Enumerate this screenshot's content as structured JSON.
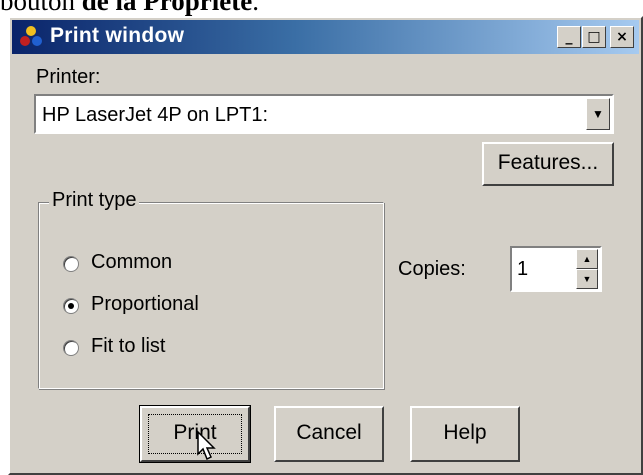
{
  "caption": {
    "prefix": "bouton ",
    "bold": "de la Propriété",
    "suffix": "."
  },
  "window": {
    "title": "Print window",
    "title_icon": "app-icon",
    "controls": {
      "minimize": "_",
      "maximize": "□",
      "close": "×"
    }
  },
  "printer": {
    "label": "Printer:",
    "selected": "HP LaserJet 4P on LPT1:",
    "features_button": "Features..."
  },
  "print_type": {
    "legend": "Print type",
    "options": [
      {
        "label": "Common",
        "checked": false
      },
      {
        "label": "Proportional",
        "checked": true
      },
      {
        "label": "Fit to list",
        "checked": false
      }
    ]
  },
  "copies": {
    "label": "Copies:",
    "value": "1"
  },
  "buttons": {
    "print": "Print",
    "cancel": "Cancel",
    "help": "Help"
  }
}
